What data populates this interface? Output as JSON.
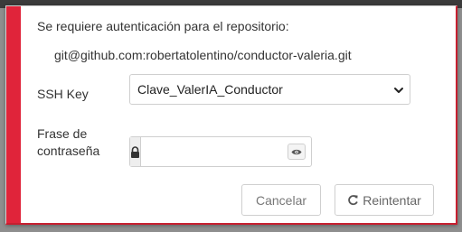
{
  "dialog": {
    "heading": "Se requiere autenticación para el repositorio:",
    "repository": "git@github.com:robertatolentino/conductor-valeria.git",
    "ssh_key_label": "SSH Key",
    "ssh_key_selected": "Clave_ValerIA_Conductor",
    "passphrase_label_line1": "Frase de",
    "passphrase_label_line2": "contraseña",
    "passphrase_value": "",
    "cancel_label": "Cancelar",
    "retry_label": "Reintentar"
  },
  "icons": {
    "lock": "lock-icon",
    "eye": "eye-icon",
    "refresh": "refresh-icon",
    "dropdown": "chevron-down-icon"
  },
  "colors": {
    "accent": "#e0243a",
    "backdrop": "#8e8e8e"
  }
}
